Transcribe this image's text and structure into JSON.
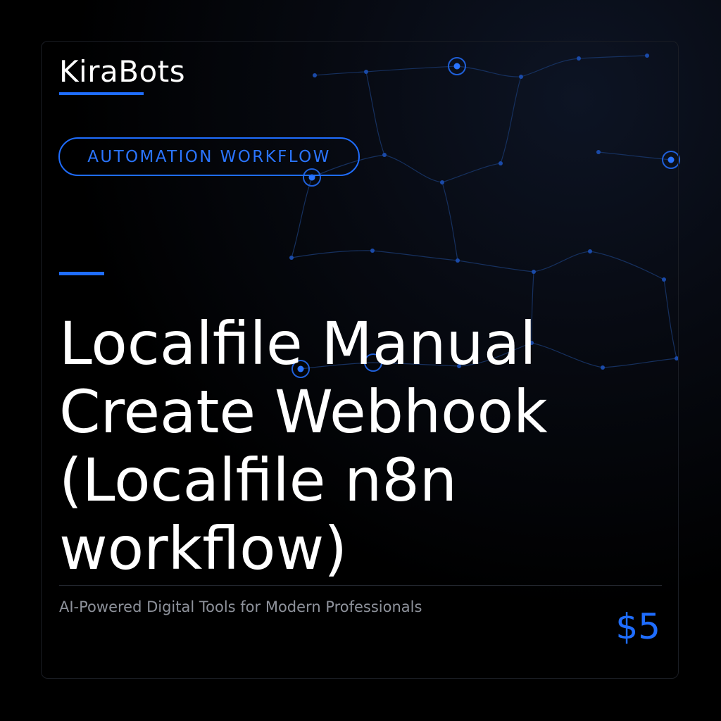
{
  "brand": {
    "name": "KiraBots",
    "accent_color": "#1f6dff"
  },
  "badge": {
    "label": "AUTOMATION WORKFLOW"
  },
  "product": {
    "title": "Localfile Manual Create Webhook (Localfile n8n workflow)",
    "tagline": "AI-Powered Digital Tools for Modern Professionals",
    "price": "$5"
  },
  "colors": {
    "background": "#000000",
    "text": "#ffffff",
    "muted_text": "#8e929b",
    "accent": "#1f6dff"
  }
}
